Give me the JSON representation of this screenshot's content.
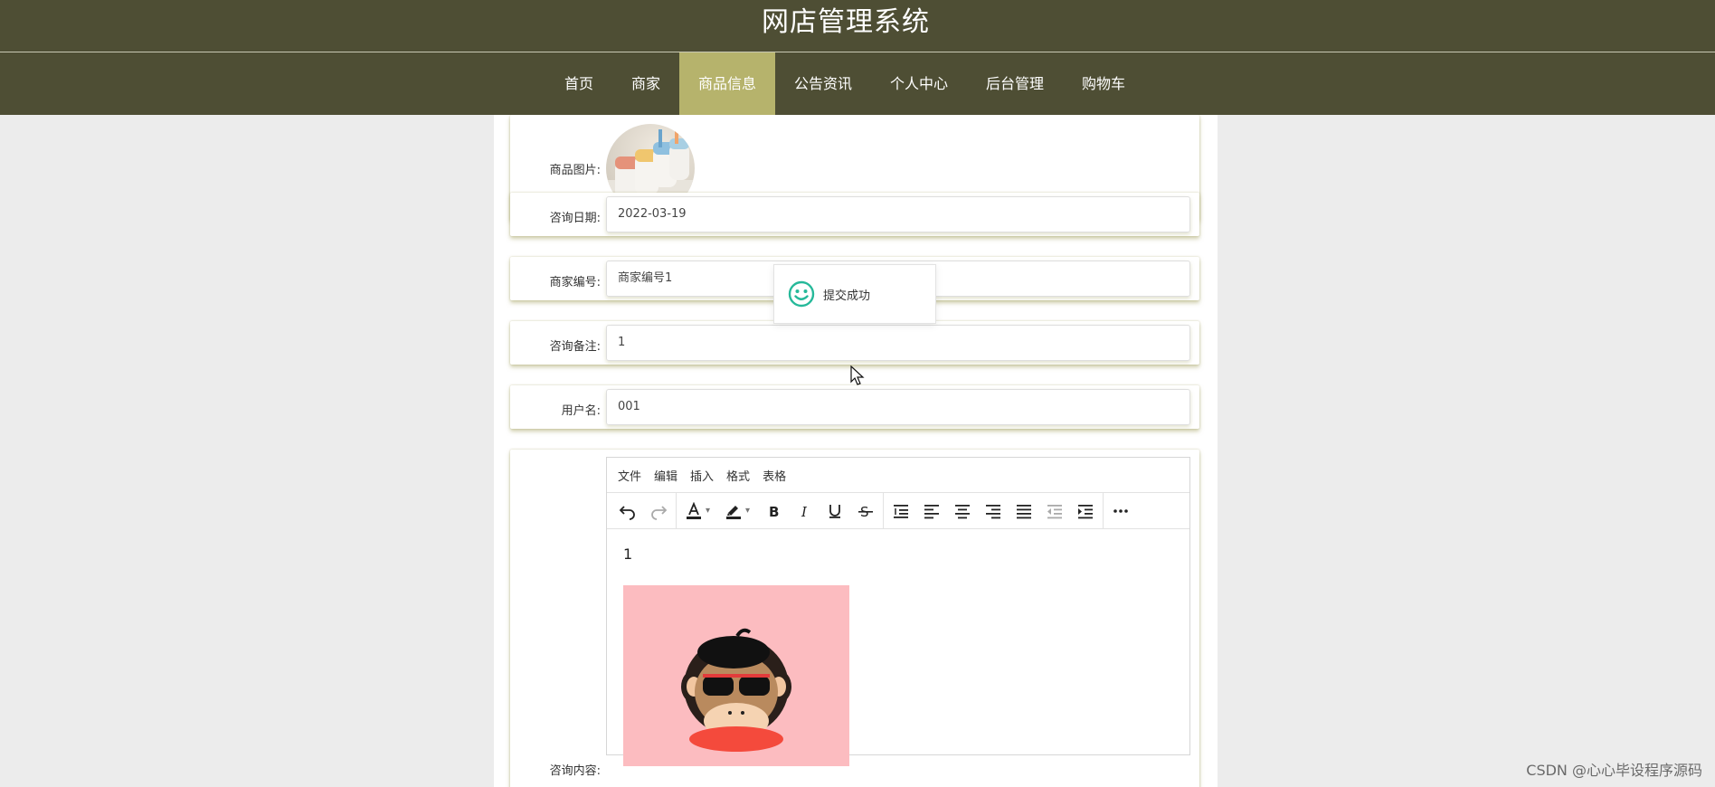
{
  "header": {
    "title": "网店管理系统",
    "nav": [
      {
        "label": "首页",
        "active": false
      },
      {
        "label": "商家",
        "active": false
      },
      {
        "label": "商品信息",
        "active": true
      },
      {
        "label": "公告资讯",
        "active": false
      },
      {
        "label": "个人中心",
        "active": false
      },
      {
        "label": "后台管理",
        "active": false
      },
      {
        "label": "购物车",
        "active": false
      }
    ]
  },
  "form": {
    "product_image_label": "商品图片:",
    "consult_date": {
      "label": "咨询日期:",
      "value": "2022-03-19"
    },
    "merchant_no": {
      "label": "商家编号:",
      "value": "商家编号1"
    },
    "consult_note": {
      "label": "咨询备注:",
      "value": "1"
    },
    "username": {
      "label": "用户名:",
      "value": "001"
    },
    "consult_content_label": "咨询内容:"
  },
  "editor": {
    "menu": [
      "文件",
      "编辑",
      "插入",
      "格式",
      "表格"
    ],
    "content_text": "1"
  },
  "toast": {
    "message": "提交成功"
  },
  "watermark": "CSDN @心心毕设程序源码",
  "colors": {
    "header_bg": "#4e4e34",
    "nav_active": "#b6b36c",
    "row_shadow": "#abaa6e",
    "toast_icon": "#26b99a"
  }
}
